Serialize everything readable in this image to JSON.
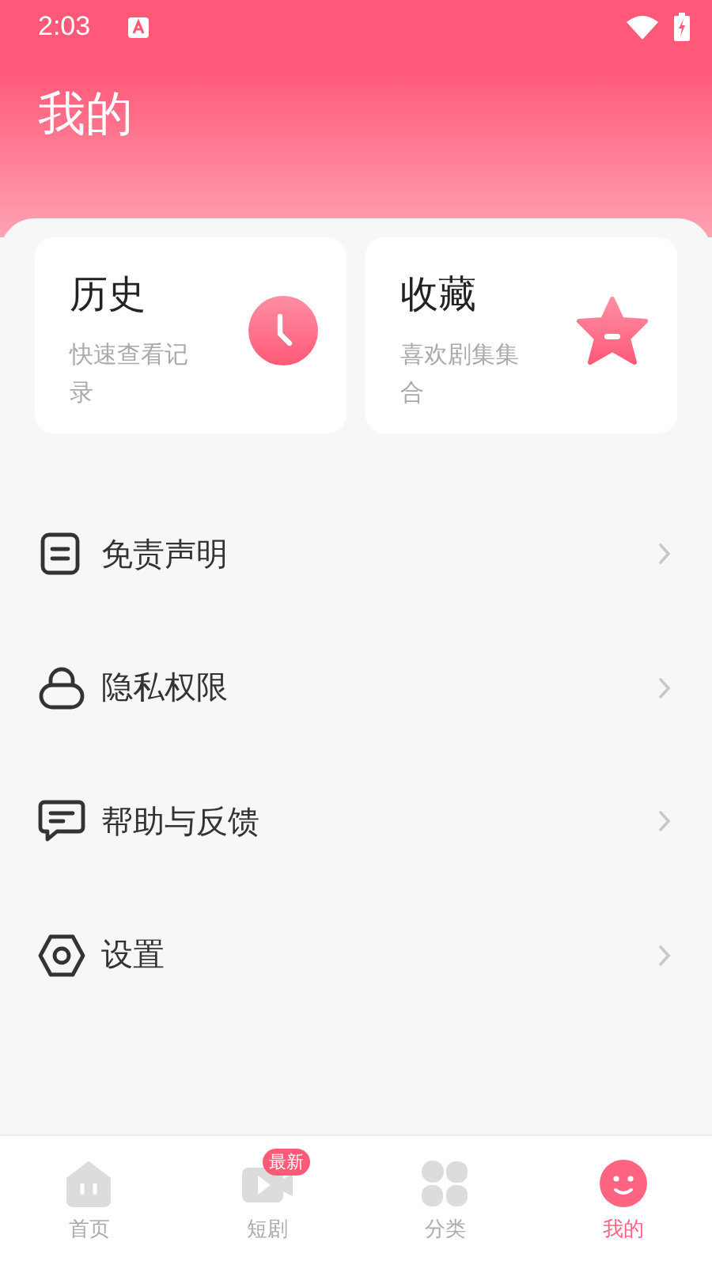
{
  "status_bar": {
    "time": "2:03"
  },
  "header": {
    "title": "我的"
  },
  "cards": [
    {
      "title": "历史",
      "subtitle": "快速查看记录",
      "kind": "clock"
    },
    {
      "title": "收藏",
      "subtitle": "喜欢剧集集合",
      "kind": "star"
    }
  ],
  "menu": [
    {
      "label": "免责声明",
      "kind": "document"
    },
    {
      "label": "隐私权限",
      "kind": "lock"
    },
    {
      "label": "帮助与反馈",
      "kind": "chat"
    },
    {
      "label": "设置",
      "kind": "settings"
    }
  ],
  "tabs": [
    {
      "label": "首页",
      "kind": "home",
      "selected": false
    },
    {
      "label": "短剧",
      "kind": "video",
      "selected": false,
      "badge": "最新"
    },
    {
      "label": "分类",
      "kind": "grid",
      "selected": false
    },
    {
      "label": "我的",
      "kind": "face",
      "selected": true
    }
  ]
}
